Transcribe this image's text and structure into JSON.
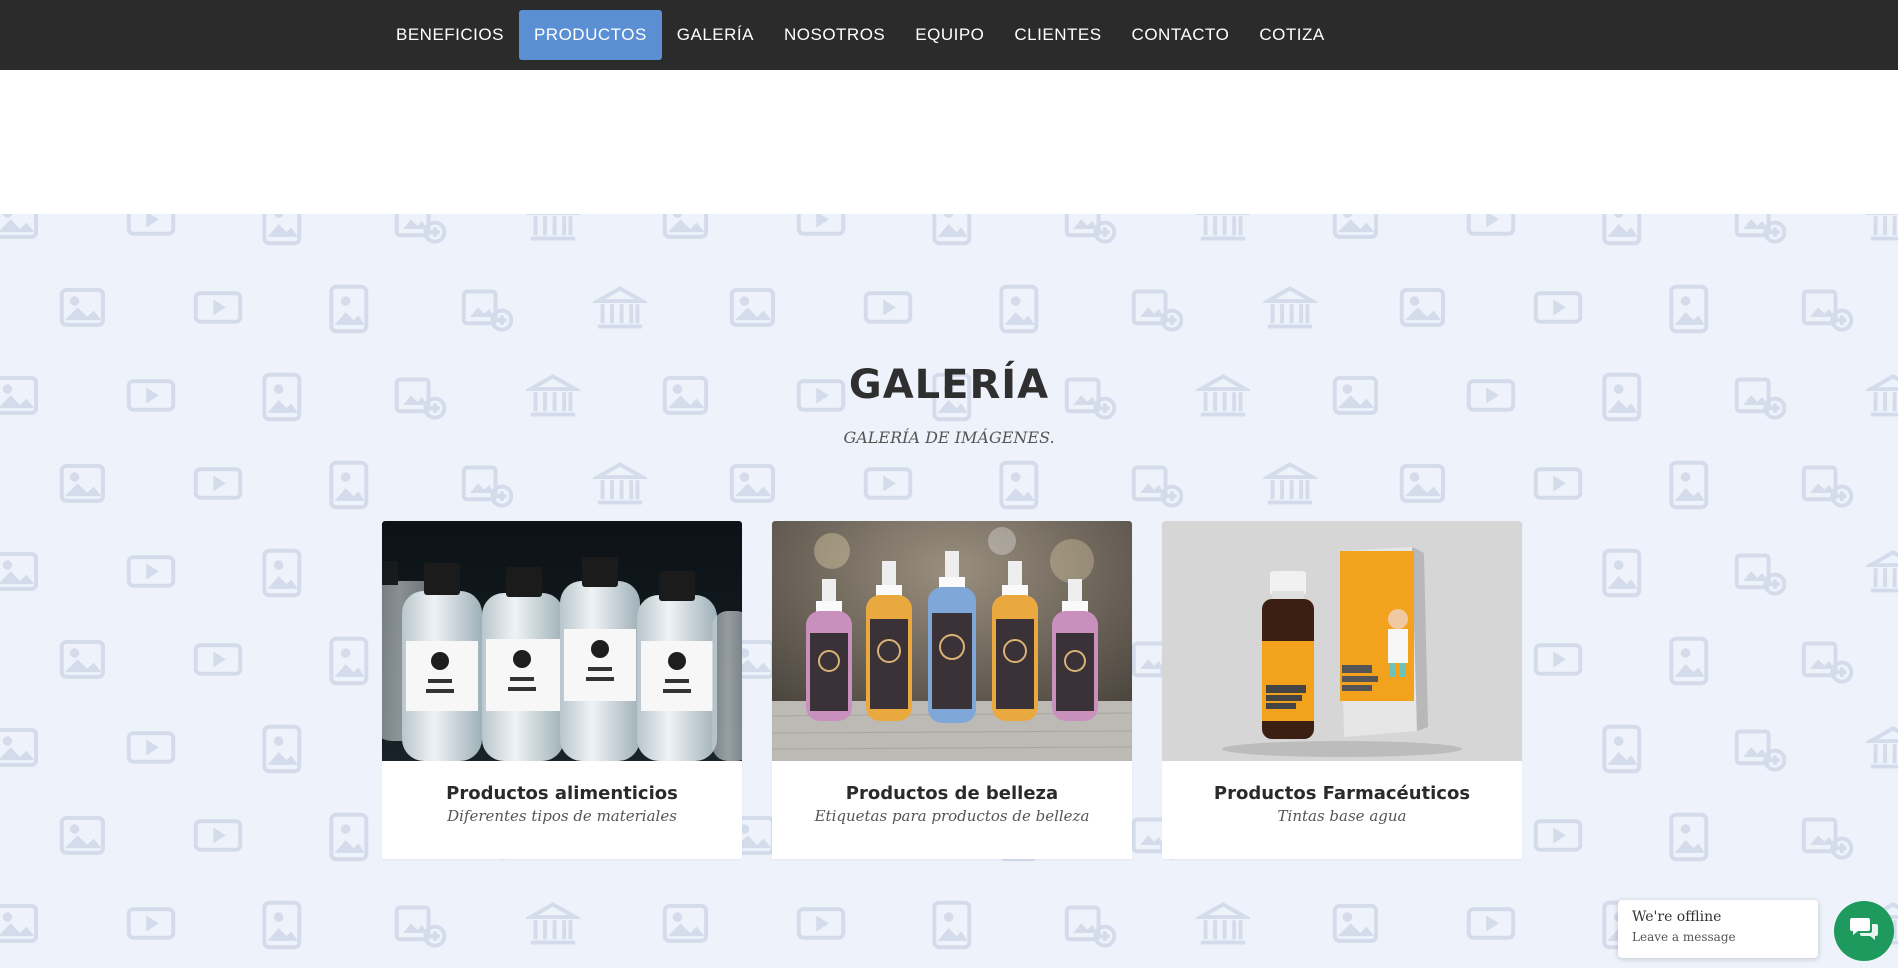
{
  "nav": {
    "items": [
      {
        "label": "BENEFICIOS"
      },
      {
        "label": "PRODUCTOS"
      },
      {
        "label": "GALERÍA"
      },
      {
        "label": "NOSOTROS"
      },
      {
        "label": "EQUIPO"
      },
      {
        "label": "CLIENTES"
      },
      {
        "label": "CONTACTO"
      },
      {
        "label": "COTIZA"
      }
    ],
    "active": "PRODUCTOS",
    "bg_color": "#2b2b2b",
    "active_color": "#5b8fd3"
  },
  "gallery": {
    "title": "GALERÍA",
    "subtitle": "GALERÍA DE IMÁGENES.",
    "bg_color": "#eef3fb",
    "cards": [
      {
        "title": "Productos alimenticios",
        "subtitle": "Diferentes tipos de materiales",
        "image": "water-bottles-mockup"
      },
      {
        "title": "Productos de belleza",
        "subtitle": "Etiquetas para productos de belleza",
        "image": "spray-bottles-mockup"
      },
      {
        "title": "Productos Farmacéuticos",
        "subtitle": "Tintas base agua",
        "image": "medical-bottle-mockup"
      }
    ]
  },
  "chat": {
    "status": "We're offline",
    "message": "Leave a message",
    "icon": "chat-bubbles-icon",
    "color": "#1f9a5e"
  }
}
